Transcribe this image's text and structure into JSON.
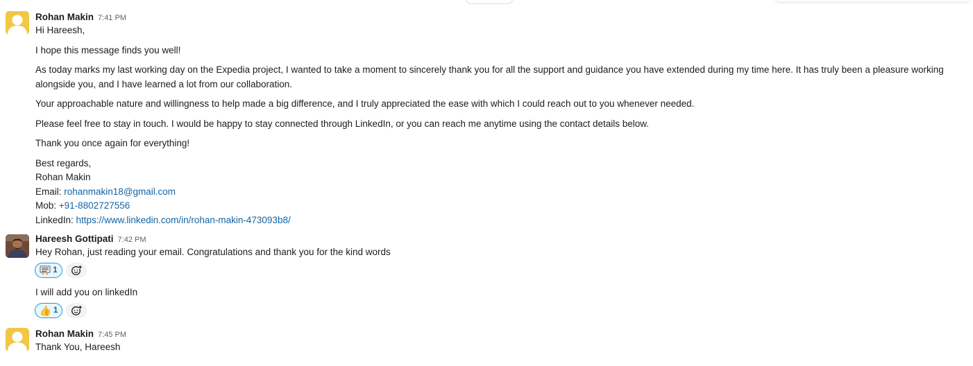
{
  "messages": [
    {
      "sender": "Rohan Makin",
      "time": "7:41 PM",
      "paragraphs": [
        "Hi Hareesh,",
        "I hope this message finds you well!",
        "As today marks my last working day on the Expedia project, I wanted to take a moment to sincerely thank you for all the support and guidance you have extended during my time here. It has truly been a pleasure working alongside you, and I have learned a lot from our collaboration.",
        "Your approachable nature and willingness to help made a big difference, and I truly appreciated the ease with which I could reach out to you whenever needed.",
        "Please feel free to stay in touch. I would be happy to stay connected through LinkedIn, or you can reach me anytime using the contact details below.",
        "Thank you once again for everything!"
      ],
      "signature": {
        "closing": "Best regards,",
        "name": "Rohan Makin",
        "email_label": "Email: ",
        "email": "rohanmakin18@gmail.com",
        "mob_label": "Mob: ",
        "mob": "+91-8802727556",
        "linkedin_label": "LinkedIn: ",
        "linkedin": "https://www.linkedin.com/in/rohan-makin-473093b8/"
      }
    },
    {
      "sender": "Hareesh Gottipati",
      "time": "7:42 PM",
      "text": "Hey Rohan, just reading your email. Congratulations and thank you for the kind words",
      "reaction": {
        "icon": "thank-you-sign-icon",
        "emoji": "🙏",
        "count": "1"
      },
      "followup_text": "I will add you on linkedIn",
      "followup_reaction": {
        "icon": "thumbs-up-icon",
        "emoji": "👍",
        "count": "1"
      }
    },
    {
      "sender": "Rohan Makin",
      "time": "7:45 PM",
      "text": "Thank You, Hareesh"
    }
  ],
  "colors": {
    "link": "#1264a3",
    "reaction_border": "#1d9bd1",
    "reaction_bg": "#e8f5fa",
    "default_avatar": "#f2c744"
  }
}
